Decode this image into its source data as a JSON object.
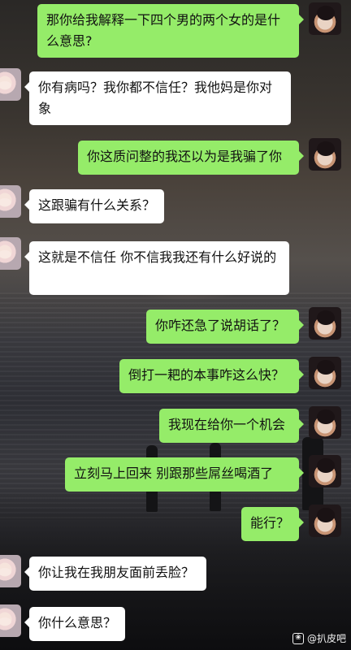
{
  "messages": [
    {
      "sender": "me",
      "text": "那你给我解释一下四个男的两个女的是什么意思?"
    },
    {
      "sender": "other",
      "text": "你有病吗？我你都不信任？我他妈是你对象"
    },
    {
      "sender": "me",
      "text": "你这质问整的我还以为是我骗了你"
    },
    {
      "sender": "other",
      "text": "这跟骗有什么关系？"
    },
    {
      "sender": "other",
      "text": "这就是不信任 你不信我我还有什么好说的"
    },
    {
      "sender": "me",
      "text": "你咋还急了说胡话了？"
    },
    {
      "sender": "me",
      "text": "倒打一耙的本事咋这么快？"
    },
    {
      "sender": "me",
      "text": "我现在给你一个机会"
    },
    {
      "sender": "me",
      "text": "立刻马上回来 别跟那些屌丝喝酒了"
    },
    {
      "sender": "me",
      "text": "能行？"
    },
    {
      "sender": "other",
      "text": "你让我在我朋友面前丢脸？"
    },
    {
      "sender": "other",
      "text": "你什么意思？"
    }
  ],
  "watermark": {
    "icon": "paw-icon",
    "text": "@扒皮吧"
  }
}
